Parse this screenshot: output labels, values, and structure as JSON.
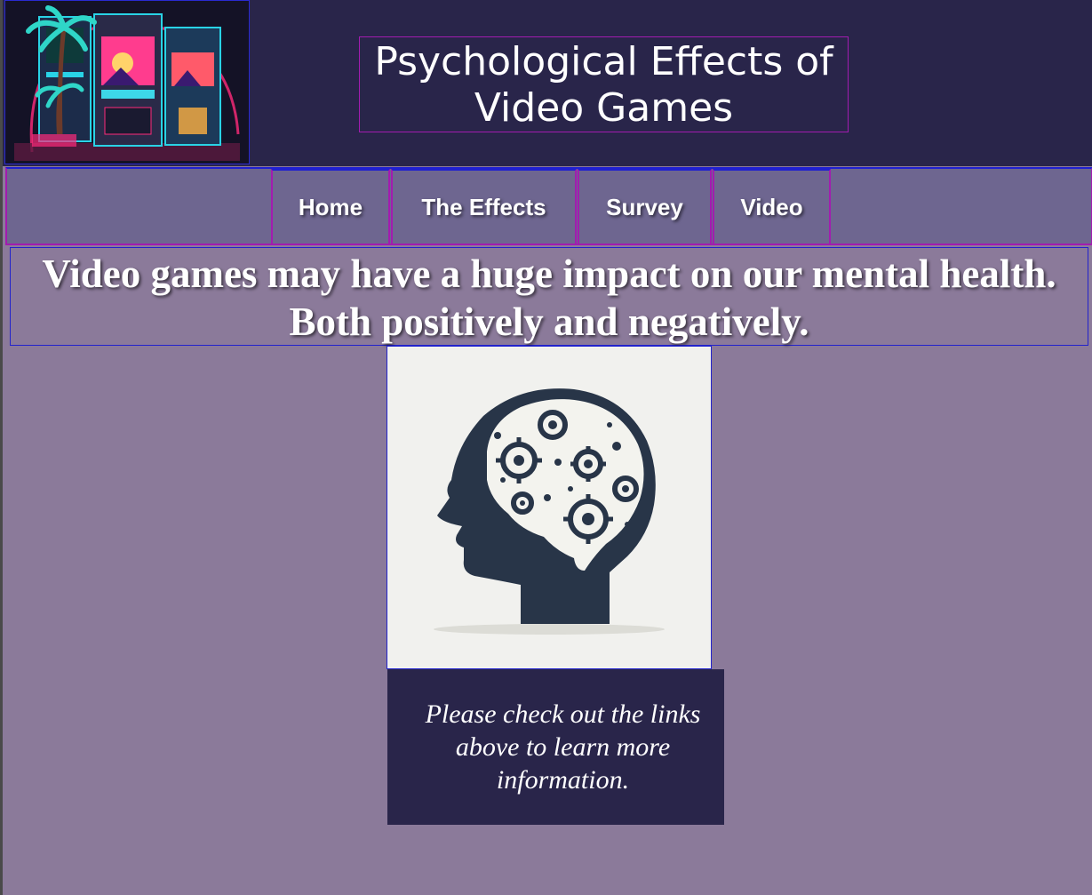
{
  "header": {
    "title": "Psychological Effects of Video Games",
    "logo_icon": "arcade-cabinets-logo"
  },
  "nav": {
    "items": [
      {
        "label": "Home"
      },
      {
        "label": "The Effects"
      },
      {
        "label": "Survey"
      },
      {
        "label": "Video"
      }
    ]
  },
  "main": {
    "headline": "Video games may have a huge impact on our mental health. Both positively and negatively.",
    "image_icon": "brain-gears-head-icon",
    "cta_text": "Please check out the links above to learn more information."
  },
  "colors": {
    "header_bg": "#29254a",
    "nav_bg": "#6e6690",
    "page_bg": "#8b7a9a",
    "border_magenta": "#a21caf",
    "border_blue": "#2222cc"
  }
}
